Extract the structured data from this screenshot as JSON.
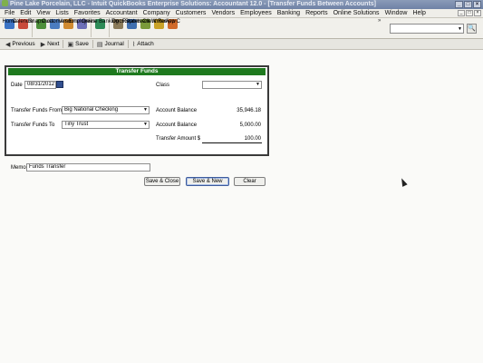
{
  "window": {
    "title": "Pine Lake Porcelain, LLC  -  Intuit QuickBooks Enterprise Solutions: Accountant 12.0 - [Transfer Funds Between Accounts]",
    "controls": [
      "_",
      "□",
      "×"
    ]
  },
  "menu": {
    "items": [
      "File",
      "Edit",
      "View",
      "Lists",
      "Favorites",
      "Accountant",
      "Company",
      "Customers",
      "Vendors",
      "Employees",
      "Banking",
      "Reports",
      "Online Solutions",
      "Window",
      "Help"
    ],
    "mdi_controls": [
      "_",
      "□",
      "×"
    ]
  },
  "icon_bar": {
    "items": [
      {
        "label": "Home",
        "icon": "home-icon",
        "color": "#3b73c4"
      },
      {
        "label": "Calendar",
        "icon": "calendar-icon",
        "color": "#c94a3a"
      },
      {
        "label": "Snapshots",
        "icon": "snapshots-icon",
        "color": "#4d8f3a"
      },
      {
        "label": "Customers",
        "icon": "customers-icon",
        "color": "#4a7cc0"
      },
      {
        "label": "Vendors",
        "icon": "vendors-icon",
        "color": "#d08a2f"
      },
      {
        "label": "Employees",
        "icon": "employees-icon",
        "color": "#6d6fb8"
      },
      {
        "label": "Online Banking",
        "icon": "online-banking-icon",
        "color": "#2e8b57"
      },
      {
        "label": "Docs",
        "icon": "docs-icon",
        "color": "#8b7b5a"
      },
      {
        "label": "Reports",
        "icon": "reports-icon",
        "color": "#3f6fb0"
      },
      {
        "label": "Statement Writer",
        "icon": "statement-writer-icon",
        "color": "#7a9a3a"
      },
      {
        "label": "Client Review",
        "icon": "client-review-icon",
        "color": "#c9a227"
      },
      {
        "label": "App C",
        "icon": "app-center-icon",
        "color": "#d06a2a"
      }
    ],
    "more": "»",
    "search_placeholder": "",
    "search_button": "🔍"
  },
  "form_toolbar": {
    "previous": "Previous",
    "next": "Next",
    "save": "Save",
    "journal": "Journal",
    "attach": "Attach"
  },
  "transfer": {
    "header": "Transfer Funds",
    "date_label": "Date",
    "date_value": "08/31/2012",
    "class_label": "Class",
    "class_value": "",
    "from_label": "Transfer Funds From",
    "from_value": "Big National Checking",
    "from_balance_label": "Account Balance",
    "from_balance": "35,946.18",
    "to_label": "Transfer Funds To",
    "to_value": "Tiny Trust",
    "to_balance_label": "Account Balance",
    "to_balance": "5,000.00",
    "amount_label": "Transfer Amount $",
    "amount_value": "100.00",
    "memo_label": "Memo",
    "memo_value": "Funds Transfer"
  },
  "buttons": {
    "save_close": "Save & Close",
    "save_new": "Save & New",
    "clear": "Clear"
  }
}
